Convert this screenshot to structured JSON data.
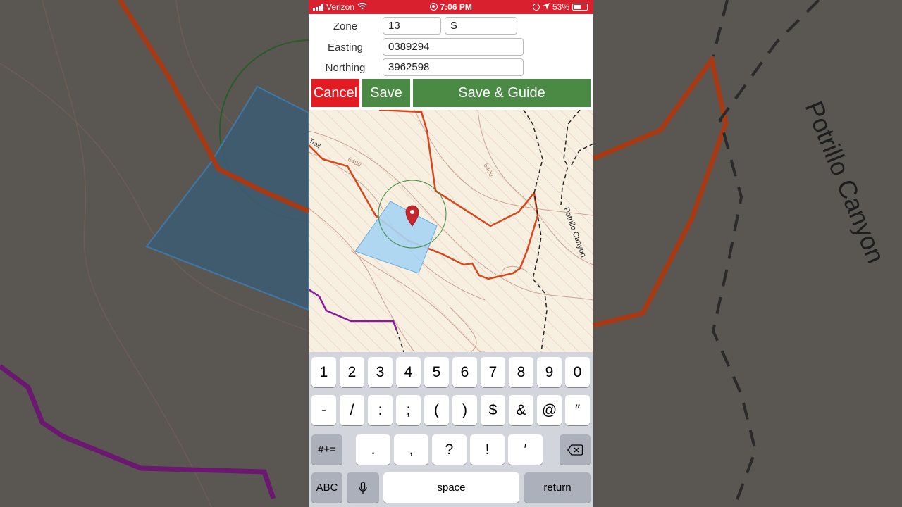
{
  "status_bar": {
    "carrier": "Verizon",
    "time": "7:06 PM",
    "battery": "53%"
  },
  "form": {
    "zone_label": "Zone",
    "zone_number": "13",
    "zone_letter": "S",
    "easting_label": "Easting",
    "easting_value": "0389294",
    "northing_label": "Northing",
    "northing_value": "3962598"
  },
  "buttons": {
    "cancel": "Cancel",
    "save": "Save",
    "save_guide": "Save & Guide"
  },
  "map": {
    "contour_label_1": "6490",
    "contour_label_2": "6400",
    "trail_label": "Potrillo Canyon",
    "trail_label_left": "Trail"
  },
  "background": {
    "trail_label": "Potrillo Canyon"
  },
  "colors": {
    "status_bar": "#d9202f",
    "cancel": "#e31b23",
    "save": "#4a8a45",
    "trail_orange": "#d9461c",
    "trail_purple": "#8b1a9b",
    "polygon_fill": "#a9d5f5"
  },
  "keyboard": {
    "row1": [
      "1",
      "2",
      "3",
      "4",
      "5",
      "6",
      "7",
      "8",
      "9",
      "0"
    ],
    "row2": [
      "-",
      "/",
      ":",
      ";",
      "(",
      ")",
      "$",
      "&",
      "@",
      "″"
    ],
    "row3": [
      ".",
      ",",
      "?",
      "!",
      "′"
    ],
    "symbols_key": "#+=",
    "abc_key": "ABC",
    "space_key": "space",
    "return_key": "return"
  }
}
